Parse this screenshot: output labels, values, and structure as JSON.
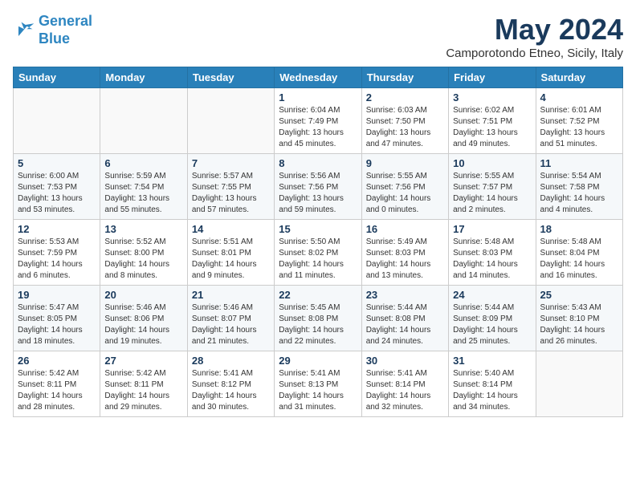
{
  "header": {
    "logo_line1": "General",
    "logo_line2": "Blue",
    "title": "May 2024",
    "subtitle": "Camporotondo Etneo, Sicily, Italy"
  },
  "days_of_week": [
    "Sunday",
    "Monday",
    "Tuesday",
    "Wednesday",
    "Thursday",
    "Friday",
    "Saturday"
  ],
  "weeks": [
    [
      {
        "day": "",
        "sunrise": "",
        "sunset": "",
        "daylight": ""
      },
      {
        "day": "",
        "sunrise": "",
        "sunset": "",
        "daylight": ""
      },
      {
        "day": "",
        "sunrise": "",
        "sunset": "",
        "daylight": ""
      },
      {
        "day": "1",
        "sunrise": "Sunrise: 6:04 AM",
        "sunset": "Sunset: 7:49 PM",
        "daylight": "Daylight: 13 hours and 45 minutes."
      },
      {
        "day": "2",
        "sunrise": "Sunrise: 6:03 AM",
        "sunset": "Sunset: 7:50 PM",
        "daylight": "Daylight: 13 hours and 47 minutes."
      },
      {
        "day": "3",
        "sunrise": "Sunrise: 6:02 AM",
        "sunset": "Sunset: 7:51 PM",
        "daylight": "Daylight: 13 hours and 49 minutes."
      },
      {
        "day": "4",
        "sunrise": "Sunrise: 6:01 AM",
        "sunset": "Sunset: 7:52 PM",
        "daylight": "Daylight: 13 hours and 51 minutes."
      }
    ],
    [
      {
        "day": "5",
        "sunrise": "Sunrise: 6:00 AM",
        "sunset": "Sunset: 7:53 PM",
        "daylight": "Daylight: 13 hours and 53 minutes."
      },
      {
        "day": "6",
        "sunrise": "Sunrise: 5:59 AM",
        "sunset": "Sunset: 7:54 PM",
        "daylight": "Daylight: 13 hours and 55 minutes."
      },
      {
        "day": "7",
        "sunrise": "Sunrise: 5:57 AM",
        "sunset": "Sunset: 7:55 PM",
        "daylight": "Daylight: 13 hours and 57 minutes."
      },
      {
        "day": "8",
        "sunrise": "Sunrise: 5:56 AM",
        "sunset": "Sunset: 7:56 PM",
        "daylight": "Daylight: 13 hours and 59 minutes."
      },
      {
        "day": "9",
        "sunrise": "Sunrise: 5:55 AM",
        "sunset": "Sunset: 7:56 PM",
        "daylight": "Daylight: 14 hours and 0 minutes."
      },
      {
        "day": "10",
        "sunrise": "Sunrise: 5:55 AM",
        "sunset": "Sunset: 7:57 PM",
        "daylight": "Daylight: 14 hours and 2 minutes."
      },
      {
        "day": "11",
        "sunrise": "Sunrise: 5:54 AM",
        "sunset": "Sunset: 7:58 PM",
        "daylight": "Daylight: 14 hours and 4 minutes."
      }
    ],
    [
      {
        "day": "12",
        "sunrise": "Sunrise: 5:53 AM",
        "sunset": "Sunset: 7:59 PM",
        "daylight": "Daylight: 14 hours and 6 minutes."
      },
      {
        "day": "13",
        "sunrise": "Sunrise: 5:52 AM",
        "sunset": "Sunset: 8:00 PM",
        "daylight": "Daylight: 14 hours and 8 minutes."
      },
      {
        "day": "14",
        "sunrise": "Sunrise: 5:51 AM",
        "sunset": "Sunset: 8:01 PM",
        "daylight": "Daylight: 14 hours and 9 minutes."
      },
      {
        "day": "15",
        "sunrise": "Sunrise: 5:50 AM",
        "sunset": "Sunset: 8:02 PM",
        "daylight": "Daylight: 14 hours and 11 minutes."
      },
      {
        "day": "16",
        "sunrise": "Sunrise: 5:49 AM",
        "sunset": "Sunset: 8:03 PM",
        "daylight": "Daylight: 14 hours and 13 minutes."
      },
      {
        "day": "17",
        "sunrise": "Sunrise: 5:48 AM",
        "sunset": "Sunset: 8:03 PM",
        "daylight": "Daylight: 14 hours and 14 minutes."
      },
      {
        "day": "18",
        "sunrise": "Sunrise: 5:48 AM",
        "sunset": "Sunset: 8:04 PM",
        "daylight": "Daylight: 14 hours and 16 minutes."
      }
    ],
    [
      {
        "day": "19",
        "sunrise": "Sunrise: 5:47 AM",
        "sunset": "Sunset: 8:05 PM",
        "daylight": "Daylight: 14 hours and 18 minutes."
      },
      {
        "day": "20",
        "sunrise": "Sunrise: 5:46 AM",
        "sunset": "Sunset: 8:06 PM",
        "daylight": "Daylight: 14 hours and 19 minutes."
      },
      {
        "day": "21",
        "sunrise": "Sunrise: 5:46 AM",
        "sunset": "Sunset: 8:07 PM",
        "daylight": "Daylight: 14 hours and 21 minutes."
      },
      {
        "day": "22",
        "sunrise": "Sunrise: 5:45 AM",
        "sunset": "Sunset: 8:08 PM",
        "daylight": "Daylight: 14 hours and 22 minutes."
      },
      {
        "day": "23",
        "sunrise": "Sunrise: 5:44 AM",
        "sunset": "Sunset: 8:08 PM",
        "daylight": "Daylight: 14 hours and 24 minutes."
      },
      {
        "day": "24",
        "sunrise": "Sunrise: 5:44 AM",
        "sunset": "Sunset: 8:09 PM",
        "daylight": "Daylight: 14 hours and 25 minutes."
      },
      {
        "day": "25",
        "sunrise": "Sunrise: 5:43 AM",
        "sunset": "Sunset: 8:10 PM",
        "daylight": "Daylight: 14 hours and 26 minutes."
      }
    ],
    [
      {
        "day": "26",
        "sunrise": "Sunrise: 5:42 AM",
        "sunset": "Sunset: 8:11 PM",
        "daylight": "Daylight: 14 hours and 28 minutes."
      },
      {
        "day": "27",
        "sunrise": "Sunrise: 5:42 AM",
        "sunset": "Sunset: 8:11 PM",
        "daylight": "Daylight: 14 hours and 29 minutes."
      },
      {
        "day": "28",
        "sunrise": "Sunrise: 5:41 AM",
        "sunset": "Sunset: 8:12 PM",
        "daylight": "Daylight: 14 hours and 30 minutes."
      },
      {
        "day": "29",
        "sunrise": "Sunrise: 5:41 AM",
        "sunset": "Sunset: 8:13 PM",
        "daylight": "Daylight: 14 hours and 31 minutes."
      },
      {
        "day": "30",
        "sunrise": "Sunrise: 5:41 AM",
        "sunset": "Sunset: 8:14 PM",
        "daylight": "Daylight: 14 hours and 32 minutes."
      },
      {
        "day": "31",
        "sunrise": "Sunrise: 5:40 AM",
        "sunset": "Sunset: 8:14 PM",
        "daylight": "Daylight: 14 hours and 34 minutes."
      },
      {
        "day": "",
        "sunrise": "",
        "sunset": "",
        "daylight": ""
      }
    ]
  ]
}
